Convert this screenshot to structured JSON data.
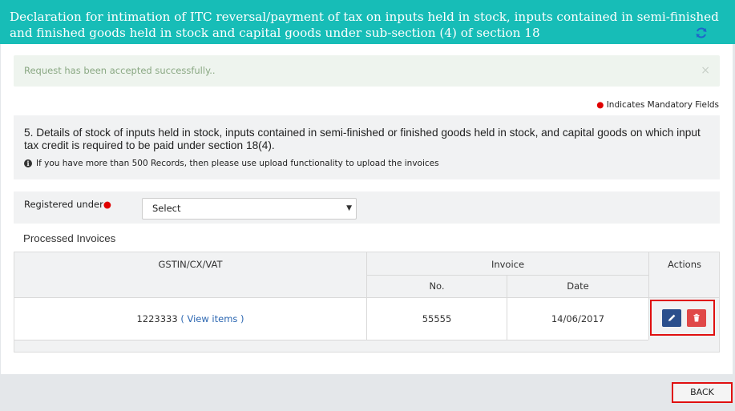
{
  "header": {
    "title": "Declaration for intimation of ITC reversal/payment of tax on inputs held in stock, inputs contained in semi-finished and finished goods held in stock and capital goods under sub-section (4) of section 18",
    "refresh_icon": "refresh-icon"
  },
  "alert": {
    "message": "Request has been accepted successfully..",
    "close_label": "×"
  },
  "mandatory_note": "Indicates Mandatory Fields",
  "section": {
    "title": "5. Details of stock of inputs held in stock, inputs contained in semi-finished or finished goods held in stock, and capital goods on which input tax credit is required to be paid under section 18(4).",
    "info_note": "If you have more than 500 Records, then please use upload functionality to upload the invoices"
  },
  "form": {
    "registered_under_label": "Registered under",
    "registered_under_value": "Select"
  },
  "processed": {
    "title": "Processed Invoices",
    "columns": {
      "gstin": "GSTIN/CX/VAT",
      "invoice": "Invoice",
      "no": "No.",
      "date": "Date",
      "actions": "Actions"
    },
    "rows": [
      {
        "gstin": "1223333",
        "view_items": "( View items )",
        "no": "55555",
        "date": "14/06/2017"
      }
    ]
  },
  "back_label": "BACK",
  "colors": {
    "header_bg": "#17bdb7",
    "edit_button": "#2b4f8c",
    "delete_button": "#e04848",
    "highlight": "#e01010"
  }
}
